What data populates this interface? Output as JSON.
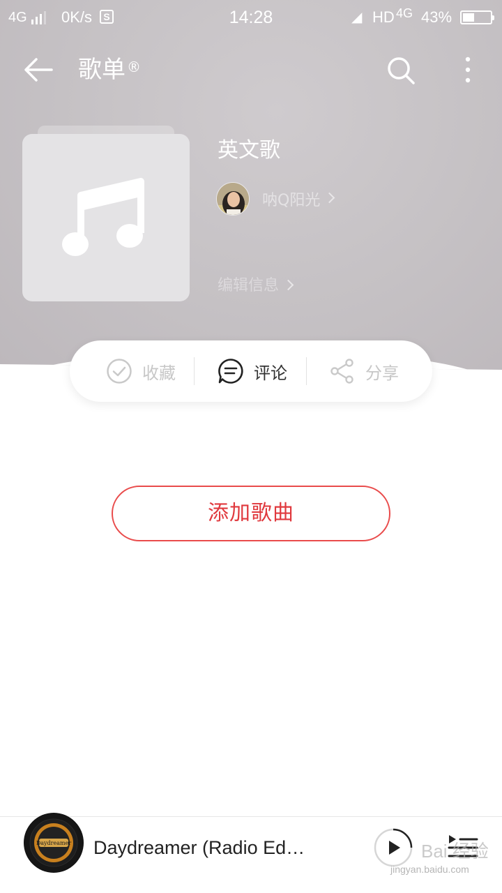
{
  "status_bar": {
    "network": "4G",
    "speed": "0K/s",
    "s_icon": "S",
    "time": "14:28",
    "hd": "HD",
    "net_type": "4G",
    "battery_percent": "43%",
    "battery_level": 0.43
  },
  "app_bar": {
    "title": "歌单",
    "title_mark": "®"
  },
  "playlist": {
    "name": "英文歌",
    "creator": "呐Q阳光",
    "edit_info": "编辑信息"
  },
  "actions": {
    "collect": "收藏",
    "comment": "评论",
    "share": "分享"
  },
  "add_songs": "添加歌曲",
  "now_playing": {
    "title": "Daydreamer (Radio Ed…",
    "art_text": "Daydreamer"
  },
  "watermark": {
    "logo": "Bai 经验",
    "url": "jingyan.baidu.com"
  },
  "colors": {
    "accent": "#e0393e",
    "header_bg": "#c5c1c4"
  }
}
